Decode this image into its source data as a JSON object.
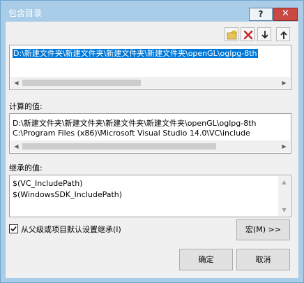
{
  "window": {
    "title": "包含目录",
    "help_label": "?",
    "close_label": "✕"
  },
  "toolbar": {
    "buttons": [
      {
        "name": "new-line-button",
        "icon": "new-folder-icon"
      },
      {
        "name": "delete-line-button",
        "icon": "delete-icon"
      },
      {
        "name": "move-down-button",
        "icon": "arrow-down-icon"
      },
      {
        "name": "move-up-button",
        "icon": "arrow-up-icon"
      }
    ]
  },
  "edit_list": {
    "lines": [
      "D:\\新建文件夹\\新建文件夹\\新建文件夹\\新建文件夹\\openGL\\oglpg-8th"
    ]
  },
  "computed": {
    "label": "计算的值:",
    "lines": [
      "D:\\新建文件夹\\新建文件夹\\新建文件夹\\新建文件夹\\openGL\\oglpg-8th",
      "C:\\Program Files (x86)\\Microsoft Visual Studio 14.0\\VC\\include"
    ]
  },
  "inherited": {
    "label": "继承的值:",
    "lines": [
      "$(VC_IncludePath)",
      "$(WindowsSDK_IncludePath)"
    ]
  },
  "inherit_checkbox": {
    "label": "从父级或项目默认设置继承(I)",
    "checked": true
  },
  "buttons": {
    "macros": "宏(M) >>",
    "ok": "确定",
    "cancel": "取消"
  },
  "colors": {
    "titlebar": "#a9cde8",
    "selection": "#0078d7",
    "close": "#c94942"
  }
}
